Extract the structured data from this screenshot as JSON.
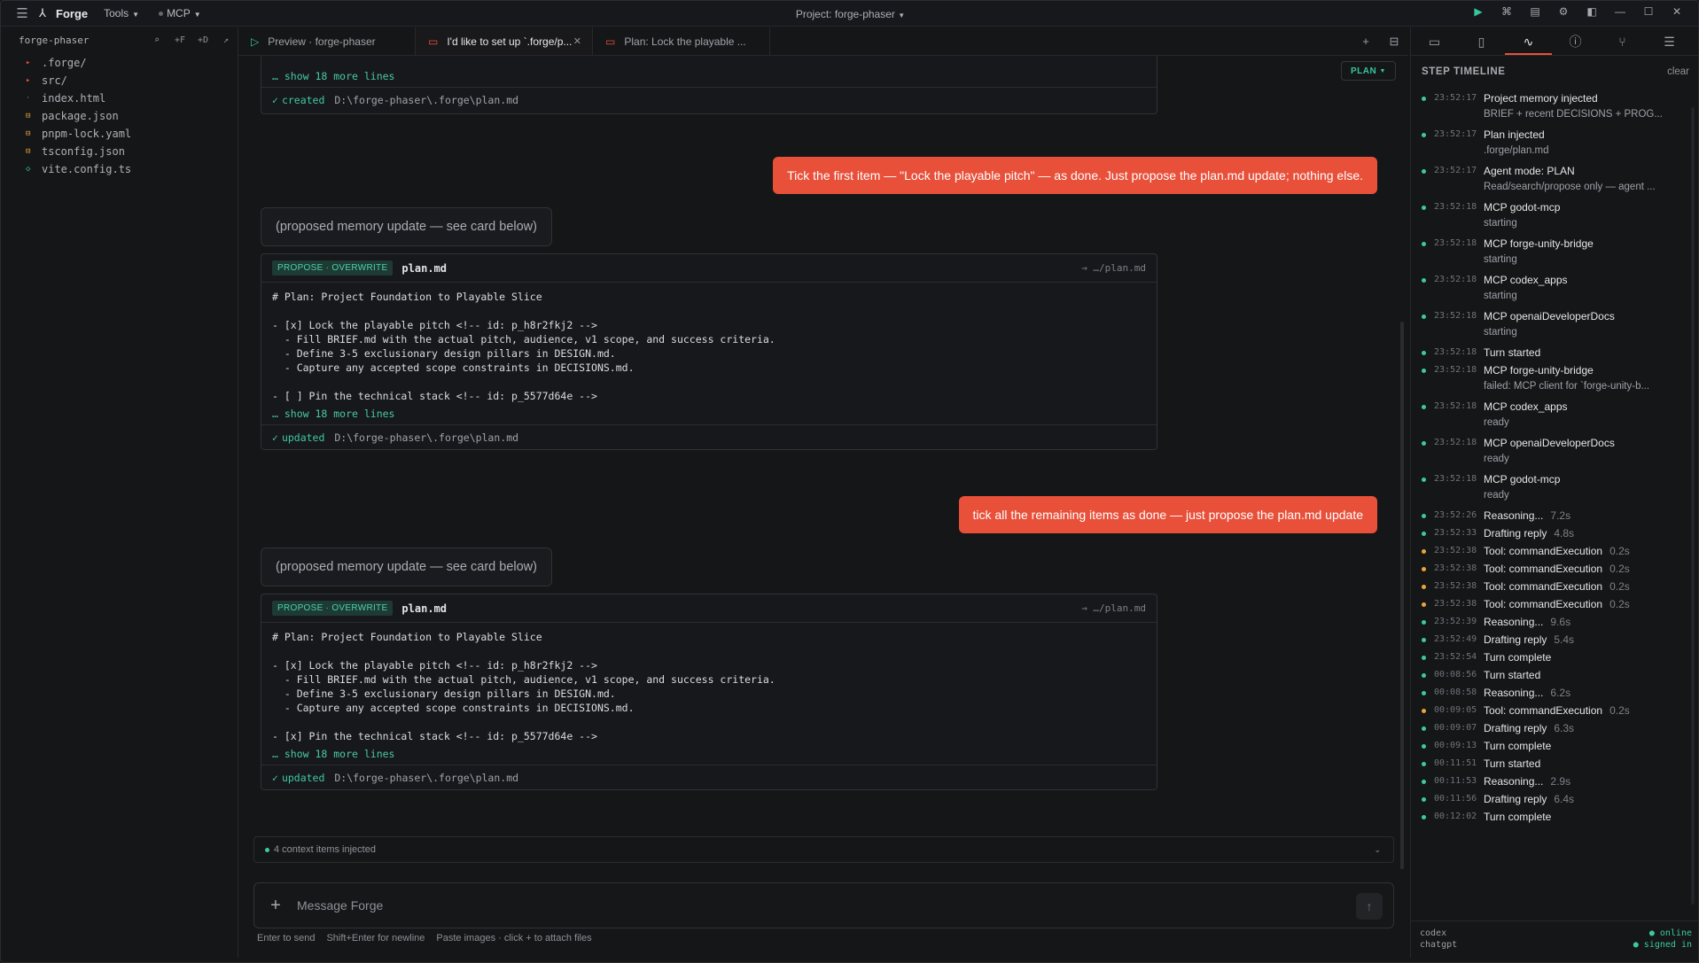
{
  "titlebar": {
    "app_name": "Forge",
    "menus": [
      "Tools",
      "MCP"
    ],
    "project": "Project: forge-phaser"
  },
  "sidebar": {
    "root": "forge-phaser",
    "actions": [
      "⌕",
      "+F",
      "+D",
      "↗"
    ],
    "files": [
      {
        "name": ".forge/",
        "kind": "folder"
      },
      {
        "name": "src/",
        "kind": "folder"
      },
      {
        "name": "index.html",
        "kind": "file"
      },
      {
        "name": "package.json",
        "kind": "json"
      },
      {
        "name": "pnpm-lock.yaml",
        "kind": "json"
      },
      {
        "name": "tsconfig.json",
        "kind": "json"
      },
      {
        "name": "vite.config.ts",
        "kind": "ts"
      }
    ]
  },
  "tabs": [
    {
      "label": "Preview · forge-phaser",
      "icon": "play"
    },
    {
      "label": "I'd like to set up `.forge/p...",
      "icon": "chat",
      "active": true
    },
    {
      "label": "Plan: Lock the playable ...",
      "icon": "chat"
    }
  ],
  "chat": {
    "mode_pill": "PLAN",
    "top_card": {
      "more": "… show 18 more lines",
      "status": "created",
      "path": "D:\\forge-phaser\\.forge\\plan.md"
    },
    "user_msg_1": "Tick the first item — \"Lock the playable pitch\" — as done. Just propose the plan.md update; nothing else.",
    "assistant_msg_1": "(proposed memory update — see card below)",
    "card_1": {
      "badge": "PROPOSE · OVERWRITE",
      "file": "plan.md",
      "path": "→ …/plan.md",
      "lines": [
        "# Plan: Project Foundation to Playable Slice",
        "",
        "- [x] Lock the playable pitch <!-- id: p_h8r2fkj2 -->",
        "  - Fill BRIEF.md with the actual pitch, audience, v1 scope, and success criteria.",
        "  - Define 3-5 exclusionary design pillars in DESIGN.md.",
        "  - Capture any accepted scope constraints in DECISIONS.md.",
        "",
        "- [ ] Pin the technical stack <!-- id: p_5577d64e -->"
      ],
      "more": "… show 18 more lines",
      "status": "updated",
      "footer_path": "D:\\forge-phaser\\.forge\\plan.md"
    },
    "user_msg_2": "tick all the remaining items as done — just propose the plan.md update",
    "assistant_msg_2": "(proposed memory update — see card below)",
    "card_2": {
      "badge": "PROPOSE · OVERWRITE",
      "file": "plan.md",
      "path": "→ …/plan.md",
      "lines": [
        "# Plan: Project Foundation to Playable Slice",
        "",
        "- [x] Lock the playable pitch <!-- id: p_h8r2fkj2 -->",
        "  - Fill BRIEF.md with the actual pitch, audience, v1 scope, and success criteria.",
        "  - Define 3-5 exclusionary design pillars in DESIGN.md.",
        "  - Capture any accepted scope constraints in DECISIONS.md.",
        "",
        "- [x] Pin the technical stack <!-- id: p_5577d64e -->"
      ],
      "more": "… show 18 more lines",
      "status": "updated",
      "footer_path": "D:\\forge-phaser\\.forge\\plan.md"
    },
    "context": "4 context items injected"
  },
  "composer": {
    "placeholder": "Message Forge",
    "hints": [
      "Enter to send",
      "Shift+Enter for newline",
      "Paste images · click + to attach files"
    ]
  },
  "right_panel": {
    "title": "STEP TIMELINE",
    "clear": "clear",
    "events": [
      {
        "time": "23:52:17",
        "label": "Project memory injected",
        "sub": "BRIEF + recent DECISIONS + PROG...",
        "color": "green"
      },
      {
        "time": "23:52:17",
        "label": "Plan injected",
        "sub": ".forge/plan.md",
        "color": "green"
      },
      {
        "time": "23:52:17",
        "label": "Agent mode: PLAN",
        "sub": "Read/search/propose only — agent ...",
        "color": "green"
      },
      {
        "time": "23:52:18",
        "label": "MCP godot-mcp",
        "sub": "starting",
        "color": "green"
      },
      {
        "time": "23:52:18",
        "label": "MCP forge-unity-bridge",
        "sub": "starting",
        "color": "green"
      },
      {
        "time": "23:52:18",
        "label": "MCP codex_apps",
        "sub": "starting",
        "color": "green"
      },
      {
        "time": "23:52:18",
        "label": "MCP openaiDeveloperDocs",
        "sub": "starting",
        "color": "green"
      },
      {
        "time": "23:52:18",
        "label": "Turn started",
        "color": "green"
      },
      {
        "time": "23:52:18",
        "label": "MCP forge-unity-bridge",
        "sub": "failed: MCP client for `forge-unity-b...",
        "color": "green"
      },
      {
        "time": "23:52:18",
        "label": "MCP codex_apps",
        "sub": "ready",
        "color": "green"
      },
      {
        "time": "23:52:18",
        "label": "MCP openaiDeveloperDocs",
        "sub": "ready",
        "color": "green"
      },
      {
        "time": "23:52:18",
        "label": "MCP godot-mcp",
        "sub": "ready",
        "color": "green"
      },
      {
        "time": "23:52:26",
        "label": "Reasoning...",
        "dur": "7.2s",
        "color": "green"
      },
      {
        "time": "23:52:33",
        "label": "Drafting reply",
        "dur": "4.8s",
        "color": "green"
      },
      {
        "time": "23:52:38",
        "label": "Tool: commandExecution",
        "dur": "0.2s",
        "color": "yellow"
      },
      {
        "time": "23:52:38",
        "label": "Tool: commandExecution",
        "dur": "0.2s",
        "color": "yellow"
      },
      {
        "time": "23:52:38",
        "label": "Tool: commandExecution",
        "dur": "0.2s",
        "color": "yellow"
      },
      {
        "time": "23:52:38",
        "label": "Tool: commandExecution",
        "dur": "0.2s",
        "color": "yellow"
      },
      {
        "time": "23:52:39",
        "label": "Reasoning...",
        "dur": "9.6s",
        "color": "green"
      },
      {
        "time": "23:52:49",
        "label": "Drafting reply",
        "dur": "5.4s",
        "color": "green"
      },
      {
        "time": "23:52:54",
        "label": "Turn complete",
        "color": "green"
      },
      {
        "time": "00:08:56",
        "label": "Turn started",
        "color": "green"
      },
      {
        "time": "00:08:58",
        "label": "Reasoning...",
        "dur": "6.2s",
        "color": "green"
      },
      {
        "time": "00:09:05",
        "label": "Tool: commandExecution",
        "dur": "0.2s",
        "color": "yellow"
      },
      {
        "time": "00:09:07",
        "label": "Drafting reply",
        "dur": "6.3s",
        "color": "green"
      },
      {
        "time": "00:09:13",
        "label": "Turn complete",
        "color": "green"
      },
      {
        "time": "00:11:51",
        "label": "Turn started",
        "color": "green"
      },
      {
        "time": "00:11:53",
        "label": "Reasoning...",
        "dur": "2.9s",
        "color": "green"
      },
      {
        "time": "00:11:56",
        "label": "Drafting reply",
        "dur": "6.4s",
        "color": "green"
      },
      {
        "time": "00:12:02",
        "label": "Turn complete",
        "color": "green"
      }
    ],
    "footer": {
      "k1": "codex",
      "v1": "● online",
      "k2": "chatgpt",
      "v2": "● signed in"
    }
  },
  "colors": {
    "accent": "#e8503a",
    "ok": "#3cc9a2",
    "warn": "#e9a53a"
  }
}
